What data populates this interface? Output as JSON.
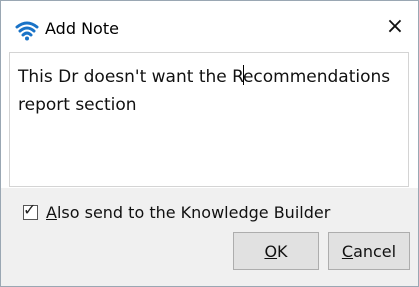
{
  "dialog": {
    "title": "Add Note",
    "close_glyph": "×"
  },
  "note": {
    "text_before_caret": "This Dr doesn't want the R",
    "text_after_caret": "ecommendations report section"
  },
  "options": {
    "also_send_checked": true,
    "also_send_label_hotkey": "A",
    "also_send_label_rest": "lso send to the Knowledge Builder"
  },
  "buttons": {
    "ok_hotkey": "O",
    "ok_rest": "K",
    "cancel_hotkey": "C",
    "cancel_rest": "ancel"
  },
  "icons": {
    "app": "wifi-logo-icon",
    "close": "close-icon",
    "checkmark": "checkmark-icon"
  },
  "colors": {
    "accent_blue": "#1a73c7",
    "footer_bg": "#f0f0f0",
    "button_bg": "#e1e1e1"
  }
}
